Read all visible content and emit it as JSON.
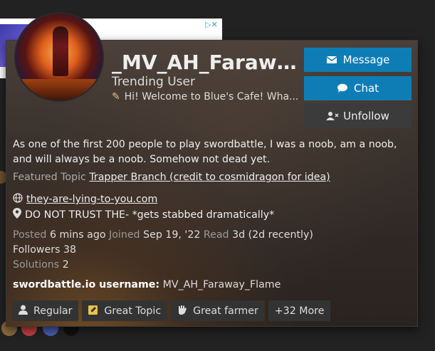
{
  "profile": {
    "username": "_MV_AH_Farawa...",
    "title": "Trending User",
    "status": "Hi! Welcome to Blue's Cafe! Wha...",
    "bio": "As one of the first 200 people to play swordbattle, I was a noob, am a noob, and will always be a noob. Somehow not dead yet.",
    "featured_label": "Featured Topic",
    "featured_topic": "Trapper Branch (credit to cosmidragon for idea)",
    "website": "they-are-lying-to-you.com",
    "location": "DO NOT TRUST THE- *gets stabbed dramatically*",
    "posted_label": "Posted",
    "posted_value": "6 mins ago",
    "joined_label": "Joined",
    "joined_value": "Sep 19, '22",
    "read_label": "Read",
    "read_value": "3d (2d recently)",
    "followers_label": "Followers",
    "followers_value": "38",
    "solutions_label": "Solutions",
    "solutions_value": "2",
    "custom_field_label": "swordbattle.io username:",
    "custom_field_value": "MV_AH_Faraway_Flame"
  },
  "actions": {
    "message": "Message",
    "chat": "Chat",
    "unfollow": "Unfollow"
  },
  "badges": [
    {
      "label": "Regular",
      "icon": "user-icon"
    },
    {
      "label": "Great Topic",
      "icon": "pen-square-icon"
    },
    {
      "label": "Great farmer",
      "icon": "certificate-icon"
    },
    {
      "label": "+32 More",
      "icon": ""
    }
  ],
  "colors": {
    "primary": "#0e7db6",
    "secondary": "#3b3b3b",
    "background": "#222222"
  }
}
